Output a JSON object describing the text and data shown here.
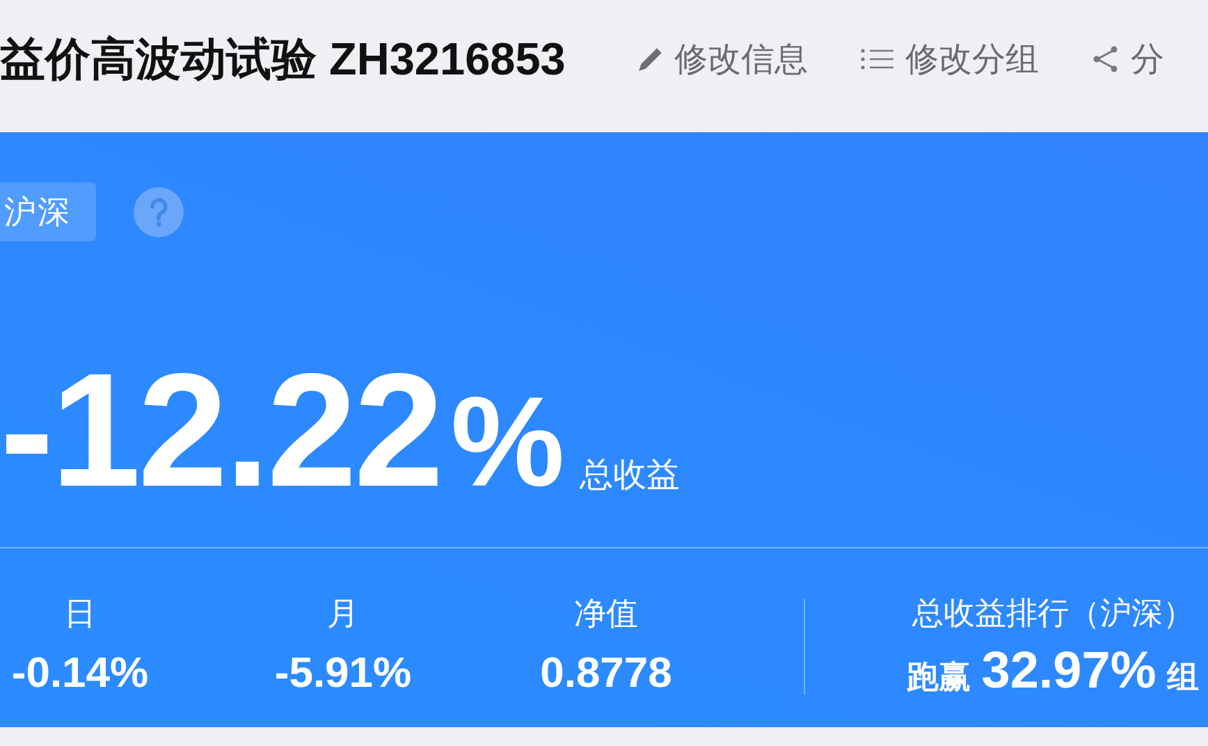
{
  "header": {
    "title": "益价高波动试验 ZH3216853",
    "actions": [
      {
        "kind": "edit",
        "label": "修改信息"
      },
      {
        "kind": "group",
        "label": "修改分组"
      },
      {
        "kind": "share",
        "label": "分"
      }
    ]
  },
  "summary": {
    "market_tag": "沪深",
    "total_return": {
      "value": "-12.22",
      "unit": "%",
      "label": "总收益"
    },
    "stats": [
      {
        "label": "日",
        "value": "-0.14%"
      },
      {
        "label": "月",
        "value": "-5.91%"
      },
      {
        "label": "净值",
        "value": "0.8778"
      }
    ],
    "ranking": {
      "label": "总收益排行（沪深）",
      "prefix": "跑赢",
      "value": "32.97%",
      "suffix": "组"
    }
  }
}
